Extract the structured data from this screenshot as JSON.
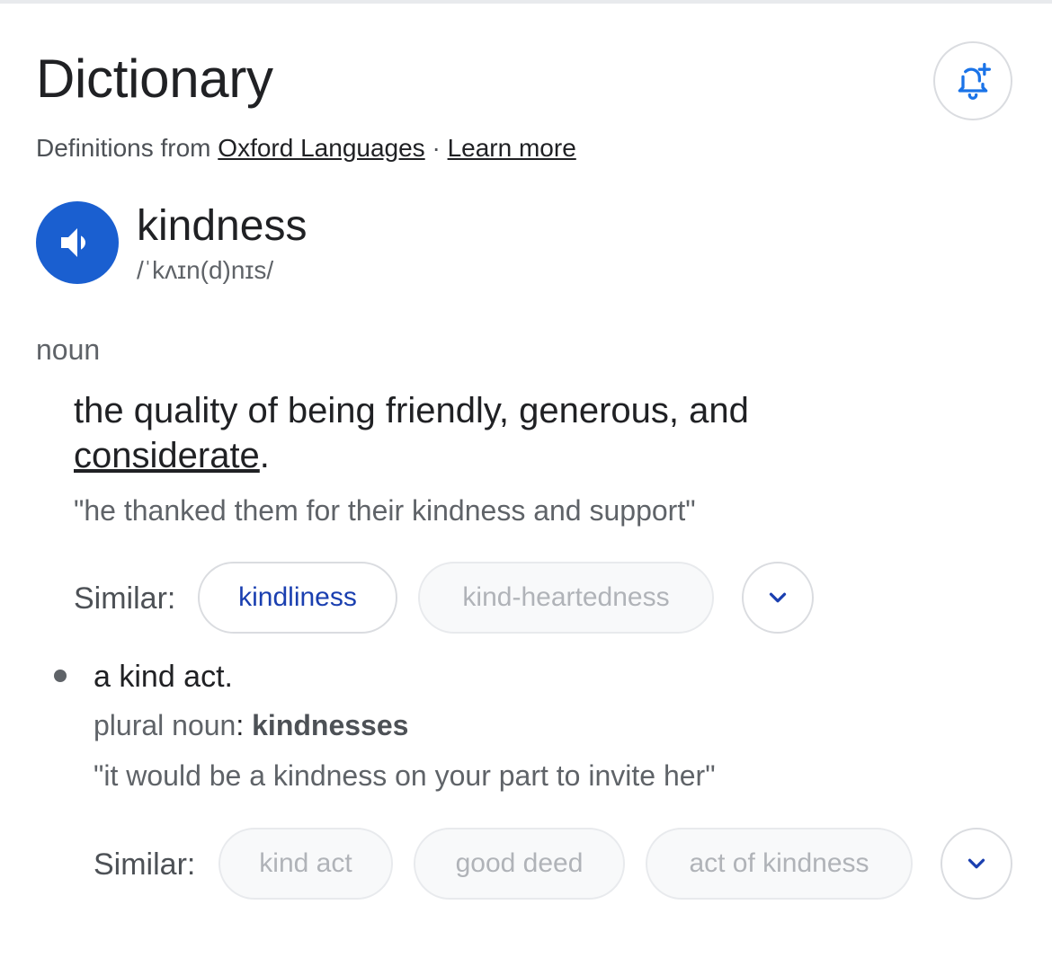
{
  "header": {
    "title": "Dictionary",
    "source_prefix": "Definitions from",
    "source_link": "Oxford Languages",
    "separator": "·",
    "learn_more": "Learn more",
    "alert_icon": "bell-plus-icon"
  },
  "entry": {
    "word": "kindness",
    "phonetic": "/ˈkʌɪn(d)nɪs/",
    "audio_icon": "speaker-icon",
    "part_of_speech": "noun"
  },
  "sense1": {
    "definition_text": "the quality of being friendly, generous, and ",
    "definition_link": "considerate",
    "definition_end": ".",
    "example": "\"he thanked them for their kindness and support\"",
    "similar_label": "Similar:",
    "similar": [
      "kindliness",
      "kind-heartedness"
    ]
  },
  "sense2": {
    "definition": "a kind act.",
    "plural_label": "plural noun",
    "plural_colon": ":",
    "plural_form": "kindnesses",
    "example": "\"it would be a kindness on your part to invite her\"",
    "similar_label": "Similar:",
    "similar": [
      "kind act",
      "good deed",
      "act of kindness"
    ]
  },
  "colors": {
    "accent_blue": "#1a5fd0",
    "link_blue": "#1a3fb0",
    "text_primary": "#202124",
    "text_secondary": "#5f6368",
    "chip_border": "#dadce0"
  }
}
